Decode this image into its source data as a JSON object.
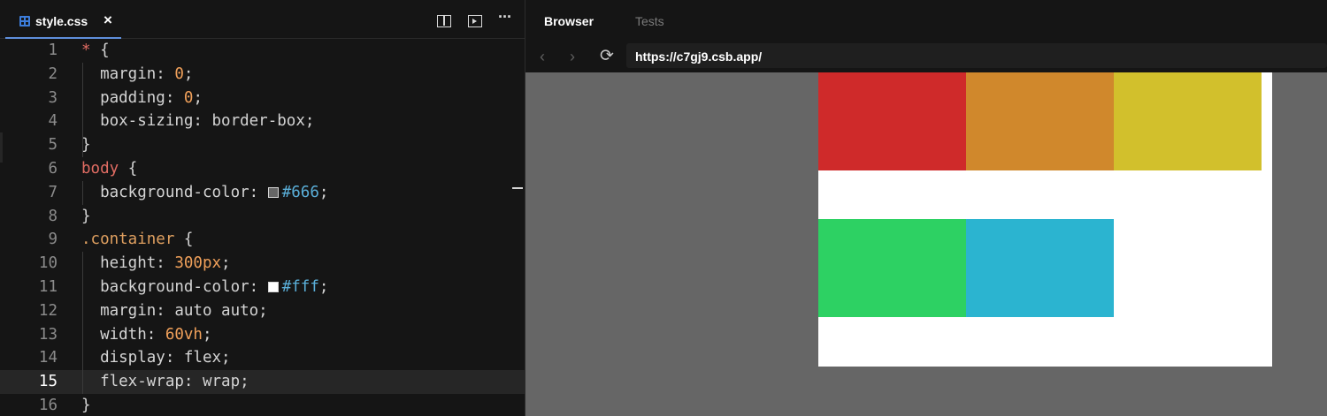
{
  "editor": {
    "tab_label": "style.css",
    "close_glyph": "×",
    "more_glyph": "···",
    "lines": [
      {
        "n": "1",
        "html": "<span class='c-sel'>*</span><span class='c-punct'> {</span>"
      },
      {
        "n": "2",
        "html": "  margin: <span class='c-num'>0</span>;"
      },
      {
        "n": "3",
        "html": "  padding: <span class='c-num'>0</span>;"
      },
      {
        "n": "4",
        "html": "  box-sizing: border-box;"
      },
      {
        "n": "5",
        "html": "}"
      },
      {
        "n": "6",
        "html": "<span class='c-sel'>body</span> {"
      },
      {
        "n": "7",
        "html": "  background-color: <span class='swatch' style='background:#666'></span><span class='c-hex'>#666</span>;"
      },
      {
        "n": "8",
        "html": "}"
      },
      {
        "n": "9",
        "html": "<span class='c-cls'>.container</span> {"
      },
      {
        "n": "10",
        "html": "  height: <span class='c-num'>300px</span>;"
      },
      {
        "n": "11",
        "html": "  background-color: <span class='swatch' style='background:#fff'></span><span class='c-hex'>#fff</span>;"
      },
      {
        "n": "12",
        "html": "  margin: auto auto;"
      },
      {
        "n": "13",
        "html": "  width: <span class='c-num'>60vh</span>;"
      },
      {
        "n": "14",
        "html": "  display: flex;"
      },
      {
        "n": "15",
        "html": "  flex-wrap: wrap;"
      },
      {
        "n": "16",
        "html": "}"
      }
    ],
    "active_line": 15
  },
  "browser": {
    "tabs": [
      "Browser",
      "Tests"
    ],
    "url": "https://c7gj9.csb.app/",
    "back_glyph": "‹",
    "forward_glyph": "›",
    "reload_glyph": "⟳",
    "page_background": "#666666",
    "container_background": "#ffffff",
    "boxes": [
      {
        "color": "#cf2a2a"
      },
      {
        "color": "#d0882c"
      },
      {
        "color": "#d2c02c"
      },
      {
        "color": "#2dd163"
      },
      {
        "color": "#2bb4d0"
      }
    ]
  }
}
